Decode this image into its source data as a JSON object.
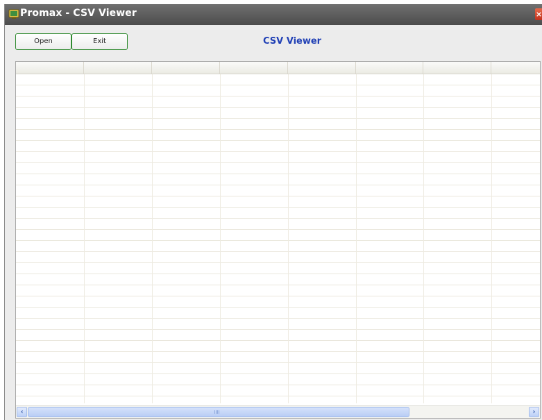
{
  "window": {
    "title": "Promax - CSV Viewer",
    "close_glyph": "×",
    "icon": "app-icon"
  },
  "toolbar": {
    "open_label": "Open",
    "exit_label": "Exit"
  },
  "header": {
    "title": "CSV Viewer",
    "title_color": "#1f3fb5"
  },
  "grid": {
    "columns": [
      "",
      "",
      "",
      "",
      "",
      "",
      "",
      ""
    ],
    "rows": []
  },
  "scrollbar": {
    "left_arrow": "‹",
    "right_arrow": "›"
  },
  "colors": {
    "button_border": "#2f8a2f",
    "titlebar": "#5a5a5a",
    "scroll_accent": "#bcd0f7"
  }
}
